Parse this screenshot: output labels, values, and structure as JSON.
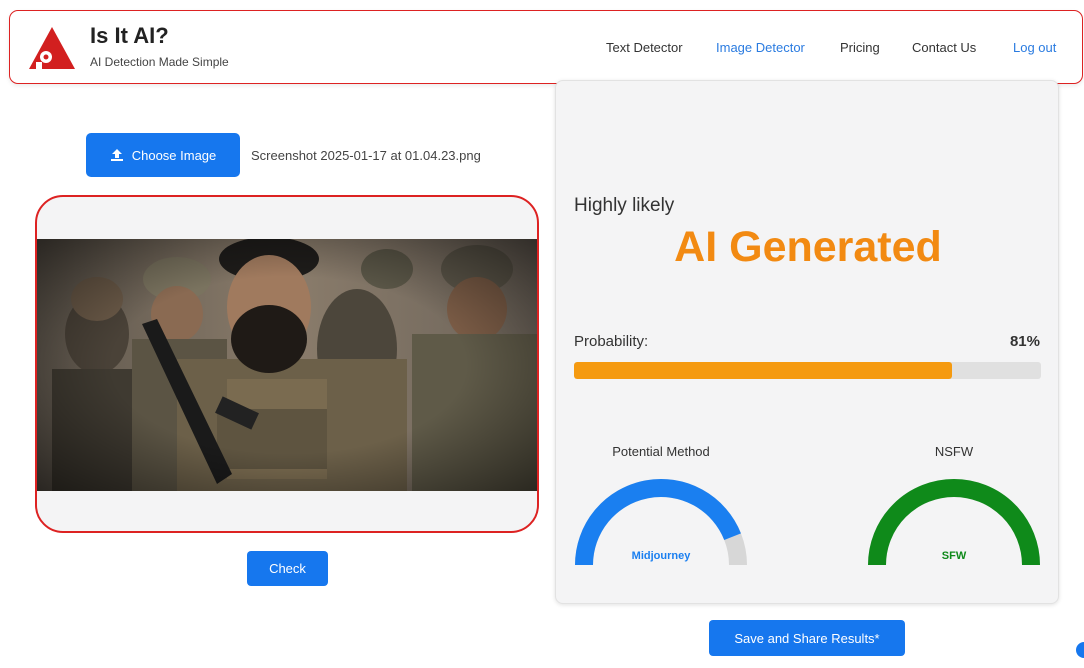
{
  "brand": {
    "title": "Is It AI?",
    "tagline": "AI Detection Made Simple",
    "logo_icon": "red-triangle-logo-icon"
  },
  "nav": {
    "items": [
      {
        "label": "Text Detector",
        "active": false
      },
      {
        "label": "Image Detector",
        "active": true
      },
      {
        "label": "Pricing",
        "active": false
      },
      {
        "label": "Contact Us",
        "active": false
      },
      {
        "label": "Log out",
        "active": false
      }
    ]
  },
  "upload": {
    "choose_label": "Choose Image",
    "choose_icon": "upload-icon",
    "file_name": "Screenshot 2025-01-17 at 01.04.23.png",
    "check_label": "Check"
  },
  "result": {
    "verdict_prefix": "Highly likely",
    "verdict": "AI Generated",
    "probability_label": "Probability:",
    "probability_text": "81%",
    "probability_fraction": 0.81,
    "method": {
      "title": "Potential Method",
      "value": "Midjourney",
      "fill_fraction": 0.88,
      "color": "#1a7ff0"
    },
    "nsfw": {
      "title": "NSFW",
      "value": "SFW",
      "fill_fraction": 1.0,
      "color": "#0f8a1a"
    }
  },
  "share": {
    "label": "Save and Share Results*"
  },
  "colors": {
    "accent": "#1677ee",
    "brand_red": "#d22222",
    "verdict_orange": "#f28a12",
    "progress_orange": "#f59a10"
  }
}
